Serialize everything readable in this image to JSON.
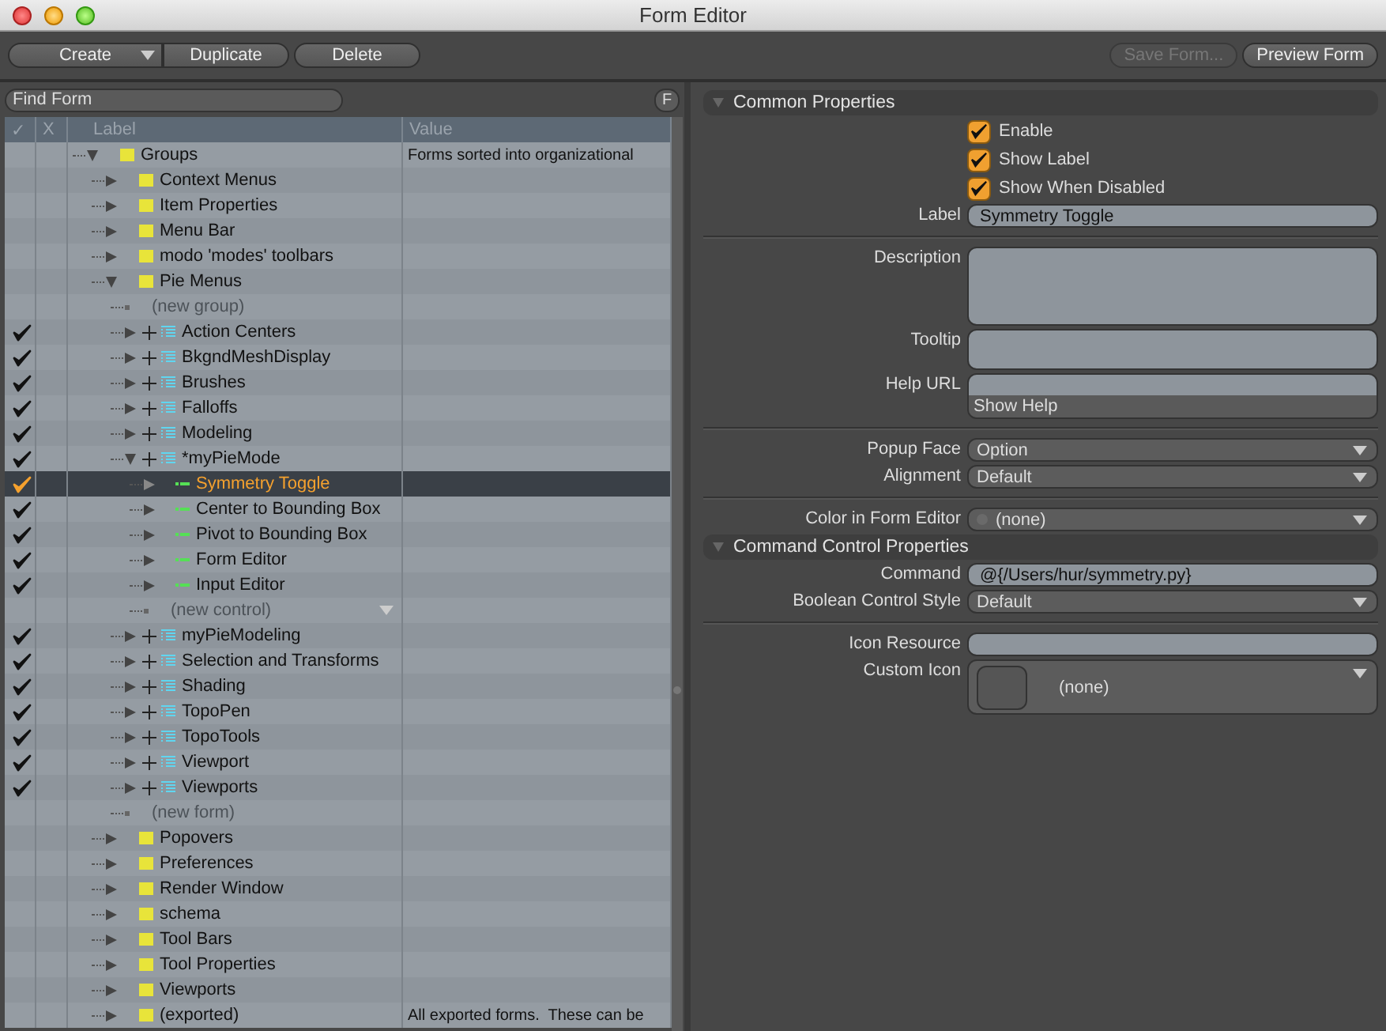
{
  "window": {
    "title": "Form Editor"
  },
  "toolbar": {
    "left_buttons": [
      {
        "label": "Create",
        "kind": "dropdown",
        "disabled": false
      },
      {
        "label": "Duplicate",
        "kind": "plain",
        "disabled": false
      },
      {
        "label": "Delete",
        "kind": "plain",
        "disabled": false
      }
    ],
    "right_buttons": [
      {
        "label": "Save Form...",
        "kind": "plain",
        "disabled": true
      },
      {
        "label": "Preview Form",
        "kind": "plain",
        "disabled": false
      }
    ]
  },
  "tree_panel": {
    "search": {
      "placeholder": "Find Form"
    },
    "filter_button": "F",
    "columns": [
      {
        "kind": "check",
        "label": "✓"
      },
      {
        "kind": "x",
        "label": "X"
      },
      {
        "kind": "label",
        "label": "Label"
      },
      {
        "kind": "value",
        "label": "Value"
      }
    ],
    "rows": [
      {
        "label": "Groups",
        "kind": "group",
        "expanded": true,
        "checked": false,
        "selected": false,
        "value": "Forms sorted into organizational",
        "children": [
          {
            "label": "Context Menus",
            "kind": "group",
            "expanded": false,
            "checked": false,
            "selected": false
          },
          {
            "label": "Item Properties",
            "kind": "group",
            "expanded": false,
            "checked": false,
            "selected": false
          },
          {
            "label": "Menu Bar",
            "kind": "group",
            "expanded": false,
            "checked": false,
            "selected": false
          },
          {
            "label": "modo 'modes' toolbars",
            "kind": "group",
            "expanded": false,
            "checked": false,
            "selected": false
          },
          {
            "label": "Pie Menus",
            "kind": "group",
            "expanded": true,
            "checked": false,
            "selected": false,
            "children": [
              {
                "label": "(new group)",
                "kind": "placeholder",
                "checked": false,
                "selected": false
              },
              {
                "label": "Action Centers",
                "kind": "form",
                "expanded": false,
                "checked": true,
                "selected": false
              },
              {
                "label": "BkgndMeshDisplay",
                "kind": "form",
                "expanded": false,
                "checked": true,
                "selected": false
              },
              {
                "label": "Brushes",
                "kind": "form",
                "expanded": false,
                "checked": true,
                "selected": false
              },
              {
                "label": "Falloffs",
                "kind": "form",
                "expanded": false,
                "checked": true,
                "selected": false
              },
              {
                "label": "Modeling",
                "kind": "form",
                "expanded": false,
                "checked": true,
                "selected": false
              },
              {
                "label": "*myPieMode",
                "kind": "form",
                "expanded": true,
                "checked": true,
                "selected": false,
                "children": [
                  {
                    "label": "Symmetry Toggle",
                    "kind": "control",
                    "expanded": false,
                    "checked": true,
                    "selected": true
                  },
                  {
                    "label": "Center to Bounding Box",
                    "kind": "control",
                    "expanded": false,
                    "checked": true,
                    "selected": false
                  },
                  {
                    "label": "Pivot to Bounding Box",
                    "kind": "control",
                    "expanded": false,
                    "checked": true,
                    "selected": false
                  },
                  {
                    "label": "Form Editor",
                    "kind": "control",
                    "expanded": false,
                    "checked": true,
                    "selected": false
                  },
                  {
                    "label": "Input Editor",
                    "kind": "control",
                    "expanded": false,
                    "checked": true,
                    "selected": false
                  },
                  {
                    "label": "(new control)",
                    "kind": "placeholder",
                    "has_dropdown": true,
                    "checked": false,
                    "selected": false
                  }
                ]
              },
              {
                "label": "myPieModeling",
                "kind": "form",
                "expanded": false,
                "checked": true,
                "selected": false
              },
              {
                "label": "Selection and Transforms",
                "kind": "form",
                "expanded": false,
                "checked": true,
                "selected": false
              },
              {
                "label": "Shading",
                "kind": "form",
                "expanded": false,
                "checked": true,
                "selected": false
              },
              {
                "label": "TopoPen",
                "kind": "form",
                "expanded": false,
                "checked": true,
                "selected": false
              },
              {
                "label": "TopoTools",
                "kind": "form",
                "expanded": false,
                "checked": true,
                "selected": false
              },
              {
                "label": "Viewport",
                "kind": "form",
                "expanded": false,
                "checked": true,
                "selected": false
              },
              {
                "label": "Viewports",
                "kind": "form",
                "expanded": false,
                "checked": true,
                "selected": false
              },
              {
                "label": "(new form)",
                "kind": "placeholder",
                "checked": false,
                "selected": false
              }
            ]
          },
          {
            "label": "Popovers",
            "kind": "group",
            "expanded": false,
            "checked": false,
            "selected": false
          },
          {
            "label": "Preferences",
            "kind": "group",
            "expanded": false,
            "checked": false,
            "selected": false
          },
          {
            "label": "Render Window",
            "kind": "group",
            "expanded": false,
            "checked": false,
            "selected": false
          },
          {
            "label": "schema",
            "kind": "group",
            "expanded": false,
            "checked": false,
            "selected": false
          },
          {
            "label": "Tool Bars",
            "kind": "group",
            "expanded": false,
            "checked": false,
            "selected": false
          },
          {
            "label": "Tool Properties",
            "kind": "group",
            "expanded": false,
            "checked": false,
            "selected": false
          },
          {
            "label": "Viewports",
            "kind": "group",
            "expanded": false,
            "checked": false,
            "selected": false
          },
          {
            "label": "(exported)",
            "kind": "group",
            "expanded": false,
            "checked": false,
            "selected": false,
            "value": "All exported forms.  These can be"
          }
        ]
      }
    ]
  },
  "properties": {
    "sections": [
      {
        "title": "Common Properties",
        "expanded": true,
        "rows": [
          {
            "kind": "checkbox",
            "label": "Enable",
            "checked": true
          },
          {
            "kind": "checkbox",
            "label": "Show Label",
            "checked": true
          },
          {
            "kind": "checkbox",
            "label": "Show When Disabled",
            "checked": true
          },
          {
            "kind": "text",
            "label": "Label",
            "value": "Symmetry Toggle"
          },
          {
            "kind": "divider"
          },
          {
            "kind": "memo",
            "label": "Description"
          },
          {
            "kind": "textarea",
            "label": "Tooltip"
          },
          {
            "kind": "url",
            "label": "Help URL",
            "button": "Show Help"
          },
          {
            "kind": "divider"
          },
          {
            "kind": "dropdown",
            "label": "Popup Face",
            "value": "Option"
          },
          {
            "kind": "dropdown",
            "label": "Alignment",
            "value": "Default"
          },
          {
            "kind": "divider"
          },
          {
            "kind": "color",
            "label": "Color in Form Editor",
            "value": "(none)"
          }
        ]
      },
      {
        "title": "Command Control Properties",
        "expanded": true,
        "rows": [
          {
            "kind": "text",
            "label": "Command",
            "value": "@{/Users/hur/symmetry.py}"
          },
          {
            "kind": "dropdown",
            "label": "Boolean Control Style",
            "value": "Default"
          },
          {
            "kind": "divider"
          },
          {
            "kind": "text",
            "label": "Icon Resource",
            "value": ""
          },
          {
            "kind": "icon",
            "label": "Custom Icon",
            "value": "(none)"
          }
        ]
      }
    ]
  }
}
